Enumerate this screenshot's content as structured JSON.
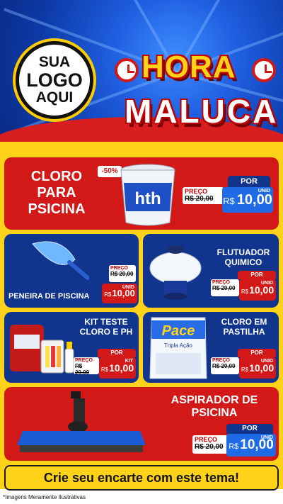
{
  "header": {
    "logo_lines": [
      "SUA",
      "LOGO",
      "AQUI"
    ],
    "title_line1": "HORA",
    "title_line2": "MALUCA",
    "icons": [
      "alarm-clock-icon"
    ]
  },
  "products": [
    {
      "name": "CLORO PARA PSICINA",
      "name_lines": [
        "CLORO",
        "PARA",
        "PSICINA"
      ],
      "discount": "-50%",
      "image_label": "hth",
      "price_label": "PREÇO",
      "old_price": "R$ 20,00",
      "por_label": "POR",
      "currency": "R$",
      "price": "10,00",
      "unit": "UNID"
    },
    {
      "name": "PENEIRA DE PISCINA",
      "price_label": "PREÇO",
      "old_price": "R$ 20,00",
      "currency": "R$",
      "price": "10,00",
      "unit": "UNID"
    },
    {
      "name": "FLUTUADOR QUIMICO",
      "name_lines": [
        "FLUTUADOR",
        "QUIMICO"
      ],
      "price_label": "PREÇO",
      "old_price": "R$ 20,00",
      "por_label": "POR",
      "currency": "R$",
      "price": "10,00",
      "unit": "UNID"
    },
    {
      "name": "KIT TESTE CLORO E PH",
      "name_lines": [
        "KIT TESTE",
        "CLORO E PH"
      ],
      "price_label": "PREÇO",
      "old_price": "R$ 20,00",
      "por_label": "POR",
      "currency": "R$",
      "price": "10,00",
      "unit": "KIT"
    },
    {
      "name": "CLORO EM PASTILHA",
      "name_lines": [
        "CLORO EM",
        "PASTILHA"
      ],
      "image_label": "Pace",
      "image_sublabel": "Tripla Ação",
      "price_label": "PREÇO",
      "old_price": "R$ 20,00",
      "por_label": "POR",
      "currency": "R$",
      "price": "10,00",
      "unit": "UNID"
    },
    {
      "name": "ASPIRADOR DE PSICINA",
      "name_lines": [
        "ASPIRADOR DE",
        "PSICINA"
      ],
      "price_label": "PREÇO",
      "old_price": "R$ 20,00",
      "por_label": "POR",
      "currency": "R$",
      "price": "10,00",
      "unit": "UNID"
    }
  ],
  "footer": {
    "cta": "Crie seu encarte com este tema!",
    "disclaimer": "*Imagens Meramente Ilustrativas"
  },
  "colors": {
    "red": "#d31818",
    "blue": "#11348c",
    "yellow": "#ffd21a",
    "price_blue": "#1f6be6"
  }
}
